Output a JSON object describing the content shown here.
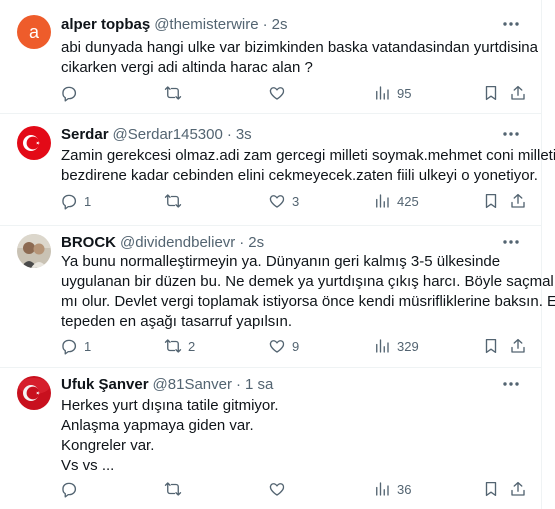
{
  "tweets": [
    {
      "name": "alper topbaş",
      "handle": "@themisterwire",
      "time": "2s",
      "avatar_letter": "a",
      "lines": [
        "abi dunyada hangi ulke var bizimkinden baska vatandasindan yurtdisina",
        "cikarken vergi adi altinda harac alan ?"
      ],
      "replies": "",
      "retweets": "",
      "likes": "",
      "views": "95"
    },
    {
      "name": "Serdar",
      "handle": "@Serdar145300",
      "time": "3s",
      "lines": [
        "Zamin gerekcesi olmaz.adi zam gercegi milleti soymak.mehmet coni milleti",
        "bezdirene kadar cebinden elini cekmeyecek.zaten fiili ulkeyi o yonetiyor."
      ],
      "replies": "1",
      "retweets": "",
      "likes": "3",
      "views": "425"
    },
    {
      "name": "BROCK",
      "handle": "@dividendbelievr",
      "time": "2s",
      "lines": [
        "Ya bunu normalleştirmeyin ya. Dünyanın geri kalmış 3-5 ülkesinde",
        "uygulanan bir düzen bu. Ne demek ya yurtdışına çıkış harcı. Böyle saçmalık",
        "mı olur. Devlet vergi toplamak istiyorsa önce kendi müsrifliklerine baksın. En",
        "tepeden en aşağı tasarruf yapılsın."
      ],
      "replies": "1",
      "retweets": "2",
      "likes": "9",
      "views": "329"
    },
    {
      "name": "Ufuk Şanver",
      "handle": "@81Sanver",
      "time": "1 sa",
      "lines": [
        "Herkes yurt dışına tatile gitmiyor.",
        "Anlaşma yapmaya giden var.",
        "Kongreler var.",
        "Vs vs ..."
      ],
      "replies": "",
      "retweets": "",
      "likes": "",
      "views": "36"
    }
  ],
  "colors": {
    "text": "#0f1419",
    "secondary": "#536471",
    "divider": "#eff3f4",
    "avatar_orange": "#ee5c2b",
    "flag_red": "#e30a17"
  }
}
